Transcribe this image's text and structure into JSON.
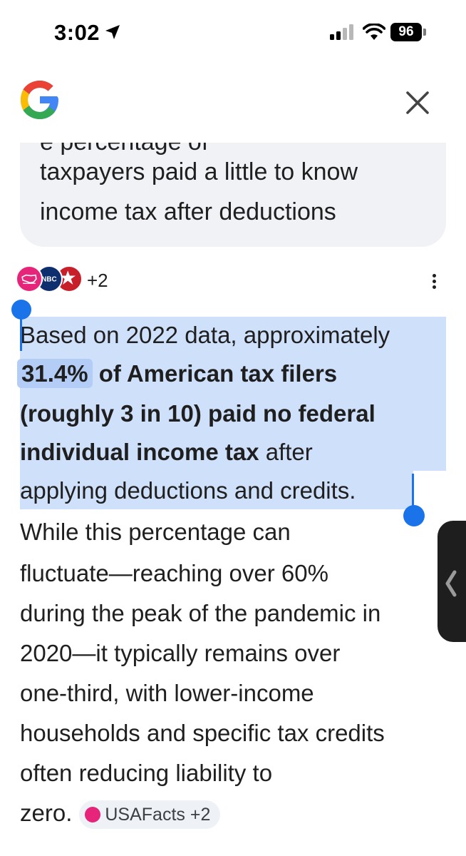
{
  "status_bar": {
    "time": "3:02",
    "battery": "96",
    "icons": [
      "location-arrow-icon",
      "signal-icon",
      "wifi-icon",
      "battery-icon"
    ]
  },
  "header": {
    "logo": "google-g-logo",
    "close_icon": "close-icon"
  },
  "query": {
    "hidden_line": "e percentage of",
    "lines": [
      "taxpayers paid a little to know",
      "income tax after deductions"
    ]
  },
  "sources": {
    "icons": [
      "usafacts-icon",
      "nbc-icon",
      "star-icon"
    ],
    "more_count": "+2",
    "menu_icon": "more-vert-icon"
  },
  "answer": {
    "l1": "Based on 2022 data, approximately",
    "l2_highlight": "31.4%",
    "l2_rest": " of American tax filers",
    "l3": "(roughly 3 in 10) paid no federal",
    "l4_bold": "individual income tax",
    "l4_rest": " after",
    "l5": "applying deductions and credits.",
    "l6": "While this percentage can",
    "l7": "fluctuate—reaching over 60%",
    "l8": "during the peak of the pandemic in",
    "l9": "2020—it typically remains over",
    "l10": "one-third, with lower-income",
    "l11": "households and specific tax credits",
    "l12": "often reducing liability to",
    "l13": "zero."
  },
  "citation": {
    "label": "USAFacts +2"
  },
  "colors": {
    "selection": "#cfe0fb",
    "selection_strong": "#b3cdf6",
    "handle": "#1a73e8",
    "bubble": "#f0f2f6",
    "chip": "#eef1f6"
  }
}
